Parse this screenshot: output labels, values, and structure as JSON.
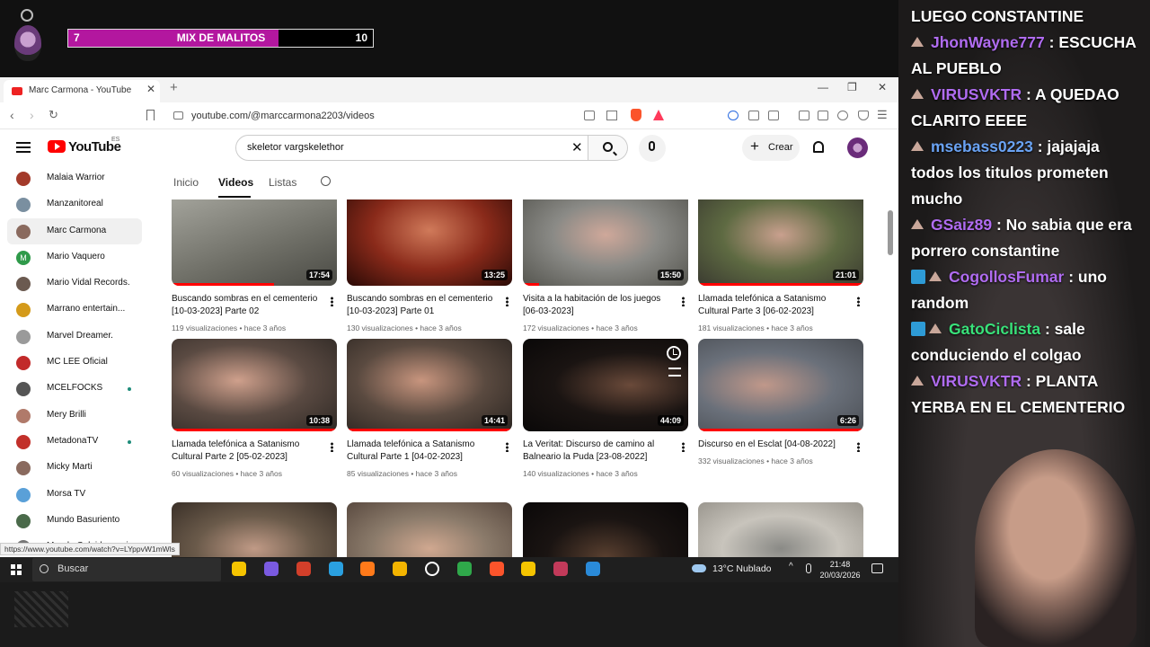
{
  "overlay": {
    "progress_left": "7",
    "progress_title": "MIX DE MALITOS",
    "progress_right": "10",
    "progress_fraction": 0.69
  },
  "browser": {
    "tab_title": "Marc Carmona - YouTube",
    "tab_close": "✕",
    "new_tab": "+",
    "url": "youtube.com/@marccarmona2203/videos",
    "status_url": "https://www.youtube.com/watch?v=LYppvW1mWls"
  },
  "youtube": {
    "logo_text": "YouTube",
    "region": "ES",
    "search_value": "skeletor vargskelethor",
    "create_label": "Crear",
    "channel_tabs": [
      "Inicio",
      "Videos",
      "Listas"
    ],
    "sidebar": [
      {
        "label": "Malaia Warrior",
        "color": "#a33a2a",
        "dot": false
      },
      {
        "label": "Manzanitoreal",
        "color": "#7a8fa0",
        "dot": false
      },
      {
        "label": "Marc Carmona",
        "color": "#8a6a5e",
        "dot": false,
        "active": true
      },
      {
        "label": "Mario Vaquero",
        "color": "#2f9a4a",
        "dot": false,
        "letter": "M"
      },
      {
        "label": "Mario Vidal Records.",
        "color": "#6b5a50",
        "dot": false
      },
      {
        "label": "Marrano entertain...",
        "color": "#d49a1a",
        "dot": false
      },
      {
        "label": "Marvel Dreamer.",
        "color": "#9a9a9a",
        "dot": false
      },
      {
        "label": "MC LEE Oficial",
        "color": "#c22a2a",
        "dot": false
      },
      {
        "label": "MCELFOCKS",
        "color": "#555555",
        "dot": true
      },
      {
        "label": "Mery Brilli",
        "color": "#b07a6a",
        "dot": false
      },
      {
        "label": "MetadonaTV",
        "color": "#c2302a",
        "dot": true
      },
      {
        "label": "Micky Marti",
        "color": "#8a6a5e",
        "dot": false
      },
      {
        "label": "Morsa TV",
        "color": "#5aa0d8",
        "dot": false
      },
      {
        "label": "Mundo Basuriento",
        "color": "#4a6a4a",
        "dot": false
      },
      {
        "label": "Mundo Caleidoscopio",
        "color": "#777777",
        "dot": false
      }
    ],
    "videos": [
      {
        "title": "Buscando sombras en el cementerio [10-03-2023] Parte 02",
        "meta": "119 visualizaciones • hace 3 años",
        "duration": "17:54",
        "watched": 0.62,
        "bg": "linear-gradient(160deg,#a6a69e,#6e6e66 60%,#4a4a44)"
      },
      {
        "title": "Buscando sombras en el cementerio [10-03-2023] Parte 01",
        "meta": "130 visualizaciones • hace 3 años",
        "duration": "13:25",
        "watched": 0.0,
        "bg": "radial-gradient(ellipse at 50% 40%,#d07a5a,#8a2a1a 50%,#2a0a06)"
      },
      {
        "title": "Visita a la habitación de los juegos [06-03-2023]",
        "meta": "172 visualizaciones • hace 3 años",
        "duration": "15:50",
        "watched": 0.1,
        "bg": "radial-gradient(ellipse at 50% 45%,#cfa89a,#8a8a86 45%,#55554f)"
      },
      {
        "title": "Llamada telefónica a Satanismo Cultural Parte 3 [06-02-2023]",
        "meta": "181 visualizaciones • hace 3 años",
        "duration": "21:01",
        "watched": 1.0,
        "bg": "radial-gradient(ellipse at 50% 45%,#c9a08e,#5e6a42 50%,#3a3a30)"
      },
      {
        "title": "Llamada telefónica a Satanismo Cultural Parte 2 [05-02-2023]",
        "meta": "60 visualizaciones • hace 3 años",
        "duration": "10:38",
        "watched": 1.0,
        "bg": "radial-gradient(ellipse at 40% 45%,#cfa08c,#5a4a42 50%,#2e2824)"
      },
      {
        "title": "Llamada telefónica a Satanismo Cultural Parte 1 [04-02-2023]",
        "meta": "85 visualizaciones • hace 3 años",
        "duration": "14:41",
        "watched": 1.0,
        "bg": "radial-gradient(ellipse at 45% 45%,#c8957e,#5a4a40 50%,#2a2420)"
      },
      {
        "title": "La Veritat: Discurso de camino al Balneario la Puda [23-08-2022]",
        "meta": "140 visualizaciones • hace 3 años",
        "duration": "44:09",
        "watched": 0.0,
        "bg": "radial-gradient(ellipse at 65% 50%,#6a4a3a,#1a1412 50%,#0a0808)"
      },
      {
        "title": "Discurso en el Esclat [04-08-2022]",
        "meta": "332 visualizaciones • hace 3 años",
        "duration": "6:26",
        "watched": 1.0,
        "bg": "radial-gradient(ellipse at 40% 50%,#c0988a,#6a707a 50%,#4a4e54)"
      },
      {
        "title": "",
        "meta": "",
        "duration": "",
        "watched": 0.0,
        "bg": "radial-gradient(ellipse at 50% 50%,#c09a86,#6a5a4a 50%,#3a3028)"
      },
      {
        "title": "",
        "meta": "",
        "duration": "",
        "watched": 0.0,
        "bg": "radial-gradient(ellipse at 50% 50%,#d0a890,#8a7a6a 50%,#5a4a40)"
      },
      {
        "title": "",
        "meta": "",
        "duration": "",
        "watched": 0.0,
        "bg": "radial-gradient(ellipse at 50% 60%,#5a4030,#1a1412 50%,#0a0808)"
      },
      {
        "title": "",
        "meta": "",
        "duration": "",
        "watched": 0.0,
        "bg": "radial-gradient(ellipse at 50% 50%,#8a8a86,#c8c4bc 50%,#9a968e)"
      }
    ]
  },
  "taskbar": {
    "search_label": "Buscar",
    "weather": "13°C  Nublado",
    "time": "21:48",
    "date": "20/03/2026",
    "caret": "^",
    "apps": [
      "#f5c400",
      "#7a5ae0",
      "#d23f2a",
      "#2aa0e0",
      "#ff7a1a",
      "#f3b400",
      "#ffffff",
      "#2fa84a",
      "#fb542b",
      "#f5c400",
      "#c23a5a",
      "#2a8ad8"
    ]
  },
  "chat": [
    {
      "user": "",
      "text": "LUEGO CONSTANTINE",
      "badge": "none",
      "color": ""
    },
    {
      "user": "JhonWayne777",
      "text": " : ESCUCHA AL PUEBLO",
      "badge": "rank",
      "color": "purple"
    },
    {
      "user": "VIRUSVKTR",
      "text": " : A QUEDAO CLARITO EEEE",
      "badge": "rank",
      "color": "purple"
    },
    {
      "user": "msebass0223",
      "text": " : jajajaja todos los titulos prometen mucho",
      "badge": "rank",
      "color": "cyan"
    },
    {
      "user": "GSaiz89",
      "text": " : No sabia que era porrero constantine",
      "badge": "rank",
      "color": "purple"
    },
    {
      "user": "CogollosFumar",
      "text": " : uno random",
      "badge": "blue",
      "color": "purple"
    },
    {
      "user": "GatoCiclista",
      "text": " : sale conduciendo el colgao",
      "badge": "blue",
      "color": "green"
    },
    {
      "user": "VIRUSVKTR",
      "text": " : PLANTA YERBA EN EL CEMENTERIO",
      "badge": "rank",
      "color": "purple"
    }
  ]
}
